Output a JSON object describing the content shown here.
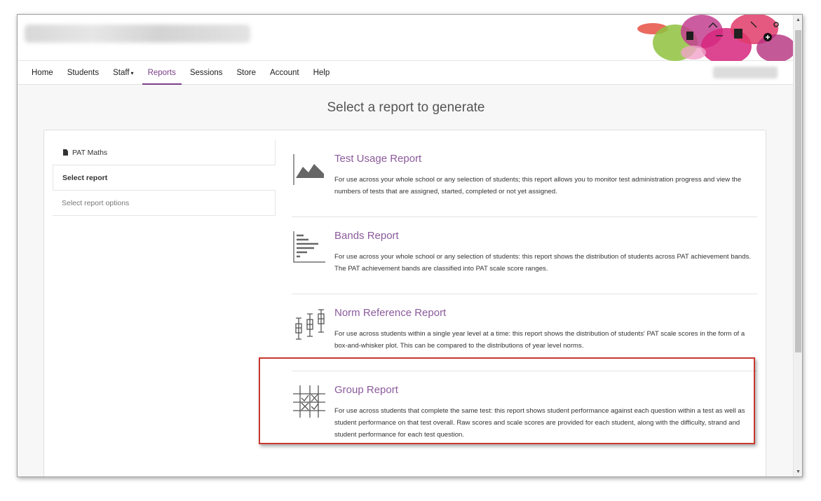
{
  "nav": {
    "items": [
      {
        "label": "Home"
      },
      {
        "label": "Students"
      },
      {
        "label": "Staff",
        "has_dropdown": true
      },
      {
        "label": "Reports",
        "active": true
      },
      {
        "label": "Sessions"
      },
      {
        "label": "Store"
      },
      {
        "label": "Account"
      },
      {
        "label": "Help"
      }
    ],
    "caret": "▾"
  },
  "page": {
    "title": "Select a report to generate"
  },
  "sidebar": {
    "items": [
      {
        "label": "PAT Maths",
        "icon": "document-icon"
      },
      {
        "label": "Select report",
        "state": "selected"
      },
      {
        "label": "Select report options",
        "state": "inactive"
      }
    ]
  },
  "reports": [
    {
      "title": "Test Usage Report",
      "icon": "area-chart-icon",
      "description": "For use across your whole school or any selection of students; this report allows you to monitor test administration progress and view the numbers of tests that are assigned, started, completed or not yet assigned."
    },
    {
      "title": "Bands Report",
      "icon": "bar-list-icon",
      "description": "For use across your whole school or any selection of students: this report shows the distribution of students across PAT achievement bands. The PAT achievement bands are classified into PAT scale score ranges."
    },
    {
      "title": "Norm Reference Report",
      "icon": "box-whisker-icon",
      "description": "For use across students within a single year level at a time: this report shows the distribution of students' PAT scale scores in the form of a box-and-whisker plot. This can be compared to the distributions of year level norms."
    },
    {
      "title": "Group Report",
      "icon": "grid-check-icon",
      "highlighted": true,
      "description": "For use across students that complete the same test: this report shows student performance against each question within a test as well as student performance on that test overall. Raw scores and scale scores are provided for each student, along with the difficulty, strand and student performance for each test question."
    }
  ],
  "colors": {
    "accent": "#7b3f8a",
    "report_title": "#8b5a9b",
    "highlight": "#c8382e"
  },
  "scrollbar": {
    "up": "▲",
    "down": "▼"
  }
}
